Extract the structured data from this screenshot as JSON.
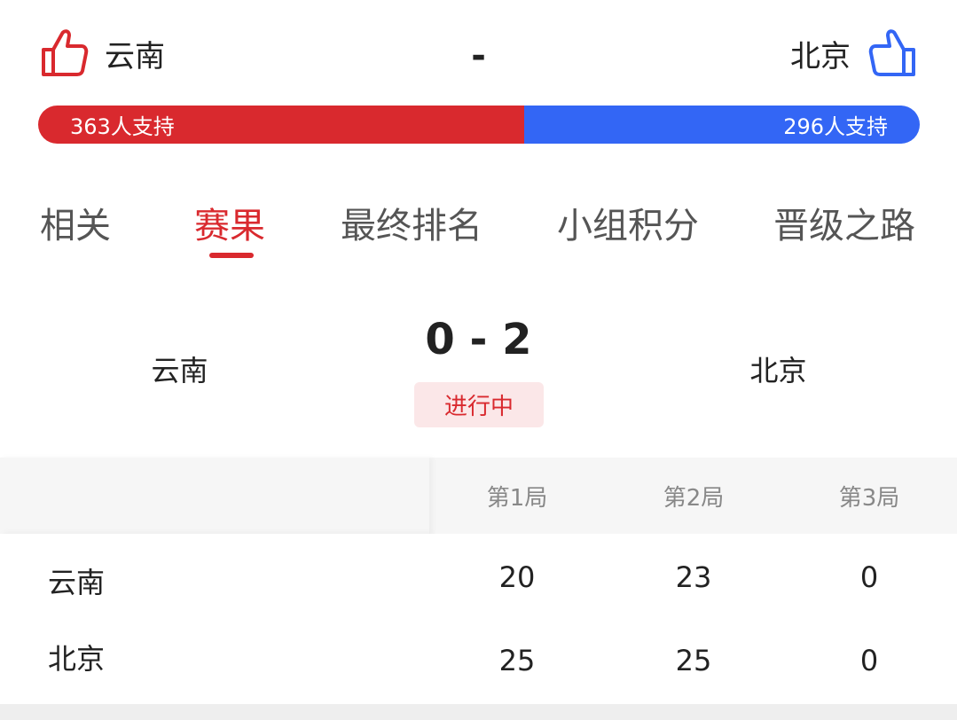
{
  "header": {
    "home_team": "云南",
    "away_team": "北京",
    "separator": "-",
    "home_support": "363人支持",
    "away_support": "296人支持",
    "home_support_count": 363,
    "away_support_count": 296,
    "home_color": "#d9292e",
    "away_color": "#3366f5",
    "home_icon": "thumbs-up-icon",
    "away_icon": "thumbs-up-icon"
  },
  "tabs": [
    {
      "label": "相关",
      "active": false
    },
    {
      "label": "赛果",
      "active": true
    },
    {
      "label": "最终排名",
      "active": false
    },
    {
      "label": "小组积分",
      "active": false
    },
    {
      "label": "晋级之路",
      "active": false
    }
  ],
  "match": {
    "home_team": "云南",
    "away_team": "北京",
    "score": "0 - 2",
    "status": "进行中"
  },
  "table": {
    "columns": [
      "第1局",
      "第2局",
      "第3局"
    ],
    "rows": [
      {
        "team": "云南",
        "scores": [
          "20",
          "23",
          "0"
        ]
      },
      {
        "team": "北京",
        "scores": [
          "25",
          "25",
          "0"
        ]
      }
    ]
  }
}
